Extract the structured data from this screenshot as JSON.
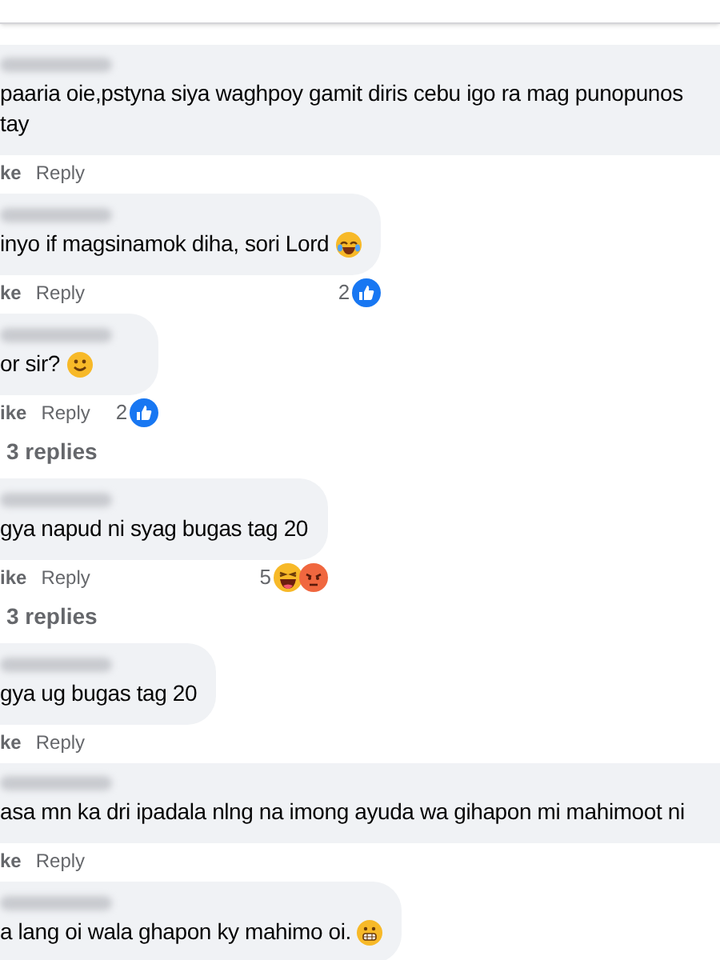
{
  "comments": [
    {
      "full": true,
      "lines": [
        "paaria oie,pstyna siya waghpoy gamit diris cebu igo ra mag punopunos",
        "tay"
      ],
      "like": "ke",
      "reply": "Reply"
    },
    {
      "full": false,
      "lines": [
        "inyo if magsinamok diha, sori Lord"
      ],
      "emoji": {
        "kind": "laugh_tears"
      },
      "like": "ke",
      "reply": "Reply",
      "reaction_count": "2",
      "reactions": [
        {
          "kind": "like"
        }
      ]
    },
    {
      "full": false,
      "lines": [
        "or sir?"
      ],
      "emoji": {
        "kind": "smile"
      },
      "like": "ike",
      "reply": "Reply",
      "reaction_count": "2",
      "reactions": [
        {
          "kind": "like"
        }
      ],
      "more_replies": "3 replies"
    },
    {
      "full": false,
      "lines": [
        "gya napud ni syag bugas tag 20"
      ],
      "like": "ike",
      "reply": "Reply",
      "reaction_count": "5",
      "reactions": [
        {
          "kind": "haha"
        },
        {
          "kind": "angry"
        }
      ],
      "more_replies": "3 replies"
    },
    {
      "full": false,
      "lines": [
        "gya ug bugas tag 20"
      ],
      "like": "ke",
      "reply": "Reply"
    },
    {
      "full": true,
      "lines": [
        "asa mn ka dri ipadala nlng na imong ayuda wa gihapon mi mahimoot ni"
      ],
      "like": "ke",
      "reply": "Reply"
    },
    {
      "full": false,
      "lines": [
        "a lang oi wala ghapon ky mahimo oi."
      ],
      "emoji": {
        "kind": "grimace"
      }
    }
  ]
}
